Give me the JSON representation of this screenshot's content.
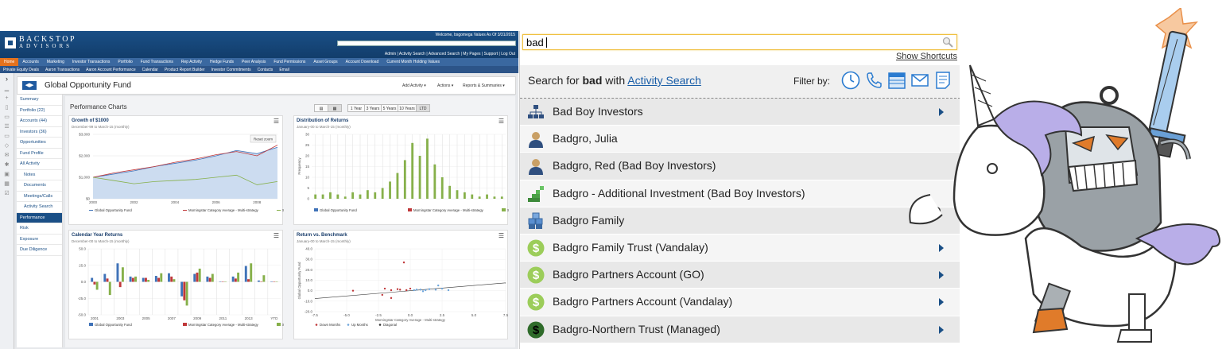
{
  "app": {
    "logo_top": "BACKSTOP",
    "logo_bottom": "ADVISORS",
    "welcome": "Welcome, bsgomega   Values As Of 3/31/2015",
    "top_links": "Admin | Activity Search | Advanced Search | My Pages | Support | Log Out",
    "nav_primary": [
      "Home",
      "Accounts",
      "Marketing",
      "Investor Transactions",
      "Portfolio",
      "Fund Transactions",
      "Rep Activity",
      "Hedge Funds",
      "Peer Analysis",
      "Fund Permissions",
      "Asset Groups",
      "Account Download",
      "Current Month Holding Values"
    ],
    "nav_secondary": [
      "Private Equity Deals",
      "Aaron Transactions",
      "Aaron Account Performance",
      "Calendar",
      "Product Report Builder",
      "Investor Commitments",
      "Contacts",
      "Email"
    ],
    "page_title": "Global Opportunity Fund",
    "actions": {
      "add": "Add Activity ▾",
      "actions": "Actions ▾",
      "reports": "Reports & Summaries ▾"
    },
    "side_nav": [
      {
        "label": "Summary"
      },
      {
        "label": "Portfolio (22)"
      },
      {
        "label": "Accounts (44)"
      },
      {
        "label": "Investors (36)"
      },
      {
        "label": "Opportunities"
      },
      {
        "label": "Fund Profile"
      },
      {
        "label": "All Activity"
      },
      {
        "label": "Notes"
      },
      {
        "label": "Documents"
      },
      {
        "label": "Meetings/Calls"
      },
      {
        "label": "Activity Search"
      },
      {
        "label": "Performance"
      },
      {
        "label": "Risk"
      },
      {
        "label": "Exposure"
      },
      {
        "label": "Due Diligence"
      }
    ],
    "section_title": "Performance Charts",
    "period_buttons": [
      "1 Year",
      "3 Years",
      "5 Years",
      "10 Years",
      "LTD"
    ],
    "panels": [
      {
        "title": "Growth of $1000",
        "sub": "December-99 to March-15 (monthly)"
      },
      {
        "title": "Distribution of Returns",
        "sub": "January-00 to March-15 (monthly)"
      },
      {
        "title": "Calendar Year Returns",
        "sub": "December-00 to March-15 (monthly)"
      },
      {
        "title": "Return vs. Benchmark",
        "sub": "January-00 to March-15 (monthly)"
      }
    ],
    "reset_zoom": "Reset zoom"
  },
  "colors": {
    "fund": "#3f72b8",
    "benchmark": "#c0383a",
    "sp500": "#86b04a",
    "brand": "#1a4f86",
    "accent": "#e4721e"
  },
  "chart_data": [
    {
      "type": "line",
      "title": "Growth of $1000",
      "x": [
        2000,
        2001,
        2002,
        2003,
        2004,
        2005,
        2006,
        2007,
        2008,
        2009
      ],
      "ylim": [
        0,
        3000
      ],
      "yticks": [
        "$3,000",
        "$2,000",
        "$1,000",
        "$0"
      ],
      "xticks": [
        "2000",
        "2002",
        "2004",
        "2006",
        "2008"
      ],
      "series": [
        {
          "name": "Global Opportunity Fund",
          "values": [
            1000,
            1150,
            1300,
            1500,
            1650,
            1800,
            2000,
            2250,
            2100,
            2400
          ]
        },
        {
          "name": "Morningstar Category Average - Multi-strategy",
          "values": [
            1000,
            1200,
            1350,
            1500,
            1700,
            1850,
            2050,
            2200,
            2000,
            2500
          ]
        },
        {
          "name": "S&P 500",
          "values": [
            1000,
            850,
            700,
            800,
            850,
            900,
            1000,
            1100,
            650,
            800
          ]
        }
      ]
    },
    {
      "type": "bar",
      "title": "Distribution of Returns",
      "ylabel": "Frequency",
      "ylim": [
        0,
        30
      ],
      "yticks": [
        "30",
        "25",
        "20",
        "15",
        "10",
        "5",
        "0"
      ],
      "series": [
        {
          "name": "Global Opportunity Fund",
          "values": []
        },
        {
          "name": "Morningstar Category Average - Multi-strategy",
          "values": []
        },
        {
          "name": "S&P 500",
          "values": [
            2,
            2,
            3,
            2,
            1,
            3,
            2,
            4,
            3,
            5,
            8,
            12,
            18,
            26,
            20,
            28,
            16,
            10,
            6,
            4,
            3,
            2,
            1,
            2,
            1,
            1
          ]
        }
      ]
    },
    {
      "type": "bar",
      "title": "Calendar Year Returns",
      "categories": [
        "2001",
        "2002",
        "2003",
        "2004",
        "2005",
        "2006",
        "2007",
        "2008",
        "2009",
        "2010",
        "2011",
        "2012",
        "2013",
        "2014",
        "YTD"
      ],
      "xticks": [
        "2001",
        "2003",
        "2005",
        "2007",
        "2009",
        "2011",
        "2013",
        "YTD"
      ],
      "ylim": [
        -50,
        50
      ],
      "yticks": [
        "50.0",
        "25.0",
        "0.0",
        "-25.0",
        "-50.0"
      ],
      "series": [
        {
          "name": "Global Opportunity Fund",
          "values": [
            6,
            12,
            28,
            8,
            6,
            9,
            13,
            -22,
            12,
            8,
            0,
            8,
            24,
            2,
            0
          ]
        },
        {
          "name": "Morningstar Category Average - Multi-strategy",
          "values": [
            -4,
            5,
            -8,
            6,
            6,
            6,
            8,
            -28,
            14,
            6,
            0,
            5,
            4,
            0,
            0
          ]
        },
        {
          "name": "S&P 500",
          "values": [
            -12,
            -20,
            22,
            8,
            3,
            13,
            4,
            -36,
            20,
            12,
            0,
            14,
            28,
            10,
            0
          ]
        }
      ]
    },
    {
      "type": "scatter",
      "title": "Return vs. Benchmark",
      "xlabel": "Morningstar Category Average - Multi-strategy",
      "ylabel": "Global Opportunity Fund",
      "xlim": [
        -7.5,
        7.5
      ],
      "ylim": [
        -20,
        40
      ],
      "xticks": [
        "-7.5",
        "-5.0",
        "-2.5",
        "0.0",
        "2.5",
        "5.0",
        "7.5"
      ],
      "yticks": [
        "40.0",
        "30.0",
        "20.0",
        "10.0",
        "0.0",
        "-10.0",
        "-20.0"
      ],
      "series": [
        {
          "name": "Down Months",
          "values": [
            [
              -4.5,
              0
            ],
            [
              -2,
              2
            ],
            [
              -1.5,
              0.5
            ],
            [
              -1,
              1.5
            ],
            [
              -0.5,
              27
            ],
            [
              -1.5,
              -7
            ],
            [
              -2.2,
              -4
            ],
            [
              -0.8,
              1
            ],
            [
              -0.3,
              0.5
            ],
            [
              0,
              2
            ]
          ]
        },
        {
          "name": "Up Months",
          "values": [
            [
              0.3,
              0.5
            ],
            [
              0.8,
              1
            ],
            [
              1.2,
              0.5
            ],
            [
              1.5,
              1.5
            ],
            [
              2,
              1
            ],
            [
              2.5,
              2
            ],
            [
              2.2,
              5
            ],
            [
              1,
              -0.5
            ],
            [
              3,
              0.5
            ],
            [
              0.5,
              1
            ]
          ]
        },
        {
          "name": "Diagonal",
          "values": [
            [
              -7.5,
              -7.5
            ],
            [
              7.5,
              7.5
            ]
          ]
        }
      ]
    }
  ],
  "search": {
    "query": "bad",
    "show_shortcuts": "Show Shortcuts",
    "header_prefix": "Search for",
    "header_term": "bad",
    "header_with": "with",
    "header_link": "Activity Search",
    "filter_by": "Filter by:",
    "results": [
      {
        "label": "Bad Boy Investors",
        "icon": "org-chart-icon",
        "arrow": true
      },
      {
        "label": "Badgro, Julia",
        "icon": "person-icon",
        "arrow": false
      },
      {
        "label": "Badgro, Red (Bad Boy Investors)",
        "icon": "person-icon",
        "arrow": false
      },
      {
        "label": "Badgro - Additional Investment (Bad Boy Investors)",
        "icon": "staircase-icon",
        "arrow": false
      },
      {
        "label": "Badgro Family",
        "icon": "cubes-icon",
        "arrow": false
      },
      {
        "label": "Badgro Family Trust (Vandalay)",
        "icon": "dollar-green-icon",
        "arrow": true
      },
      {
        "label": "Badgro Partners Account (GO)",
        "icon": "dollar-green-icon",
        "arrow": true
      },
      {
        "label": "Badgro Partners Account (Vandalay)",
        "icon": "dollar-green-icon",
        "arrow": true
      },
      {
        "label": "Badgro-Northern Trust (Managed)",
        "icon": "dollar-dark-icon",
        "arrow": true
      }
    ]
  }
}
